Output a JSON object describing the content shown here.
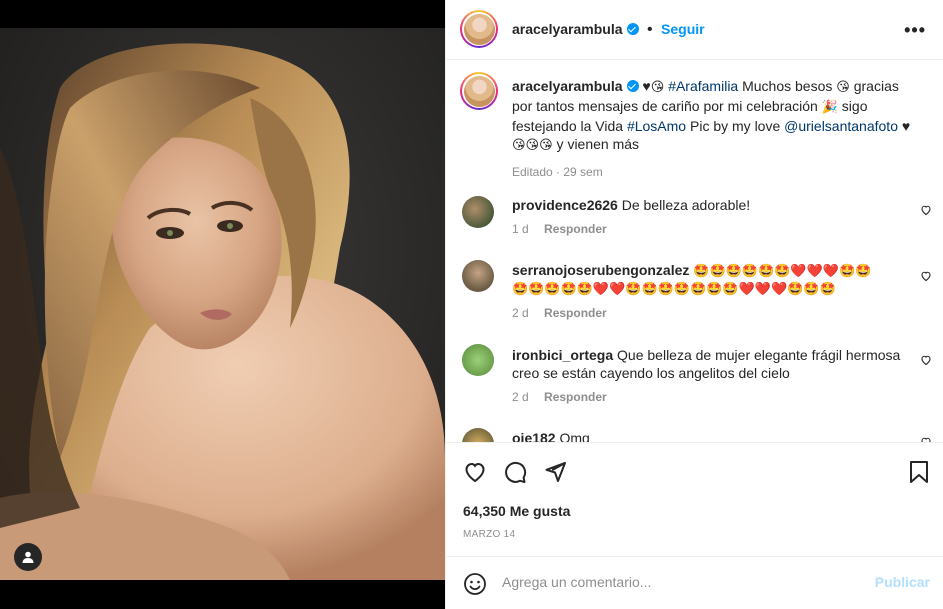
{
  "header": {
    "username": "aracelyarambula",
    "follow_label": "Seguir",
    "more_label": "•••"
  },
  "caption": {
    "username": "aracelyarambula",
    "line1_start": "♥",
    "line1_emoji": "😘",
    "hashtag1": "#Arafamilia",
    "line1_rest": " Muchos besos ",
    "line1_emoji2": "😘",
    "line1_end": " gracias",
    "line2": "por tantos mensajes de cariño por mi celebración ",
    "line2_emoji": "🎉",
    "line2_end": " sigo",
    "line3_start": "festejando la Vida ",
    "hashtag2": "#LosAmo",
    "line3_mid": " Pic by my love ",
    "mention": "@urielsantanafoto",
    "line3_end": " ♥",
    "line4_emojis": "😘😘😘",
    "line4_end": " y vienen más",
    "meta": "Editado · 29 sem"
  },
  "comments": [
    {
      "username": "providence2626",
      "text": "De belleza adorable!",
      "time": "1 d",
      "reply_label": "Responder"
    },
    {
      "username": "serranojoserubengonzalez",
      "text_line1": "🤩🤩🤩🤩🤩🤩❤️❤️❤️🤩🤩",
      "text_line2": "🤩🤩🤩🤩🤩❤️❤️🤩🤩🤩🤩🤩🤩🤩❤️❤️❤️🤩🤩🤩",
      "time": "2 d",
      "reply_label": "Responder"
    },
    {
      "username": "ironbici_ortega",
      "text_line1": "Que belleza de mujer elegante frágil hermosa",
      "text_line2": "creo se están cayendo los angelitos del cielo",
      "time": "2 d",
      "reply_label": "Responder"
    },
    {
      "username": "oje182",
      "text": "Omg",
      "time": "",
      "reply_label": ""
    }
  ],
  "actions": {
    "likes": "64,350 Me gusta",
    "date": "MARZO 14"
  },
  "add_comment": {
    "placeholder": "Agrega un comentario...",
    "post_label": "Publicar"
  },
  "colors": {
    "link": "#00376b",
    "accent": "#0095f6",
    "muted": "#8e8e8e",
    "post_disabled": "#b2dffc"
  }
}
